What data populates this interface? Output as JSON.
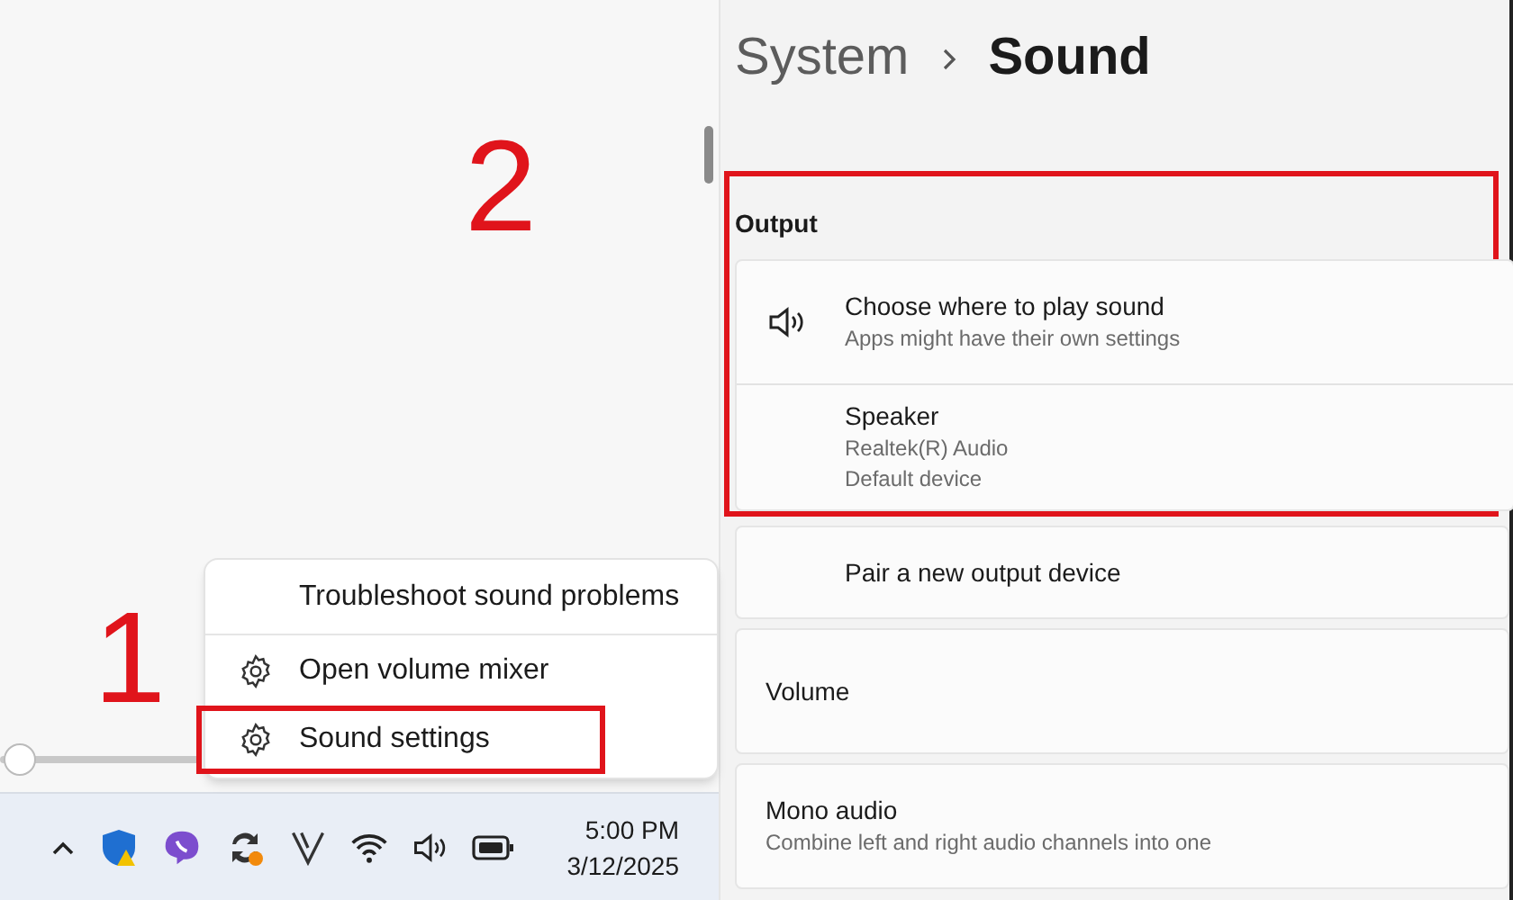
{
  "annotations": [
    {
      "label": "2"
    },
    {
      "label": "1"
    }
  ],
  "volume_slider": {
    "level": 0.02
  },
  "context_menu": {
    "items": [
      {
        "label": "Troubleshoot sound problems",
        "kind": "plain",
        "highlighted": false
      },
      {
        "label": "Open volume mixer",
        "kind": "gear",
        "highlighted": false
      },
      {
        "label": "Sound settings",
        "kind": "gear",
        "highlighted": true
      }
    ]
  },
  "taskbar": {
    "icons": [
      {
        "kind": "chevron"
      },
      {
        "kind": "shield"
      },
      {
        "kind": "chat"
      },
      {
        "kind": "sync"
      },
      {
        "kind": "v"
      },
      {
        "kind": "wifi"
      },
      {
        "kind": "speaker"
      },
      {
        "kind": "battery"
      }
    ],
    "time": "5:00 PM",
    "date": "3/12/2025"
  },
  "breadcrumb": {
    "parent": "System",
    "current": "Sound"
  },
  "sections": [
    {
      "heading": "Output",
      "highlighted": true,
      "rows": [
        {
          "kind": "icon",
          "title": "Choose where to play sound",
          "lines": [
            "Apps might have their own settings"
          ]
        },
        {
          "kind": "indented",
          "title": "Speaker",
          "lines": [
            "Realtek(R) Audio",
            "Default device"
          ]
        }
      ]
    },
    {
      "highlighted": false,
      "rows": [
        {
          "kind": "indented",
          "title": "Pair a new output device"
        }
      ]
    },
    {
      "highlighted": false,
      "rows": [
        {
          "kind": "plain",
          "title": "Volume"
        }
      ]
    },
    {
      "highlighted": false,
      "rows": [
        {
          "kind": "plain",
          "title": "Mono audio",
          "lines": [
            "Combine left and right audio channels into one"
          ]
        }
      ]
    }
  ]
}
